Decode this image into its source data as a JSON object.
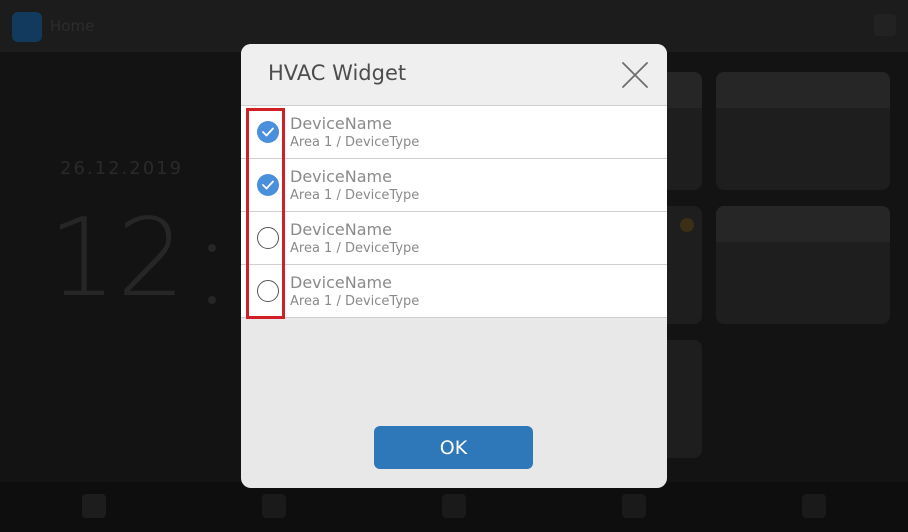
{
  "background": {
    "app_title": "Home",
    "date": "26.12.2019",
    "clock_hour": "12"
  },
  "dialog": {
    "title": "HVAC Widget",
    "close_icon": "close-x-icon",
    "ok_label": "OK",
    "devices": [
      {
        "name": "DeviceName",
        "path": "Area 1 / DeviceType",
        "checked": true
      },
      {
        "name": "DeviceName",
        "path": "Area 1 / DeviceType",
        "checked": true
      },
      {
        "name": "DeviceName",
        "path": "Area 1 / DeviceType",
        "checked": false
      },
      {
        "name": "DeviceName",
        "path": "Area 1 / DeviceType",
        "checked": false
      }
    ]
  },
  "colors": {
    "accent": "#2e77b8",
    "checkbox_on": "#4a8fdb",
    "highlight": "#d21f26"
  }
}
